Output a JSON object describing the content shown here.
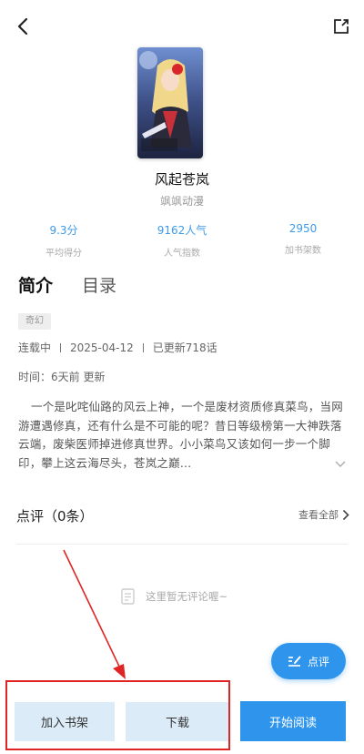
{
  "header": {
    "back_icon": "chevron-left-icon",
    "share_icon": "share-icon"
  },
  "book": {
    "title": "风起苍岚",
    "author": "飒飒动漫"
  },
  "stats": [
    {
      "value": "9.3分",
      "label": "平均得分"
    },
    {
      "value": "9162人气",
      "label": "人气指数"
    },
    {
      "value": "2950",
      "label": "加书架数"
    }
  ],
  "tabs": {
    "intro": "简介",
    "catalog": "目录"
  },
  "tag": "奇幻",
  "meta": {
    "status": "连载中",
    "date": "2025-04-12",
    "updated": "已更新718话"
  },
  "time_line": "时间：6天前 更新",
  "description": "一个是叱咤仙路的风云上神，一个是废材资质修真菜鸟，当网游遭遇修真，还有什么是不可能的呢？昔日等级榜第一大神跌落云端，废柴医师掉进修真世界。小小菜鸟又该如何一步一个脚印，攀上这云海尽头，苍岚之巅…",
  "comments": {
    "heading": "点评（0条）",
    "see_all": "查看全部",
    "empty_text": "这里暂无评论喔~",
    "fab_label": "点评"
  },
  "bottom_bar": {
    "add_shelf": "加入书架",
    "download": "下载",
    "start_reading": "开始阅读"
  },
  "colors": {
    "accent": "#2f95ec",
    "stat_value": "#3d9be9",
    "light_button": "#dcebf8",
    "annotation_red": "#e02424"
  }
}
